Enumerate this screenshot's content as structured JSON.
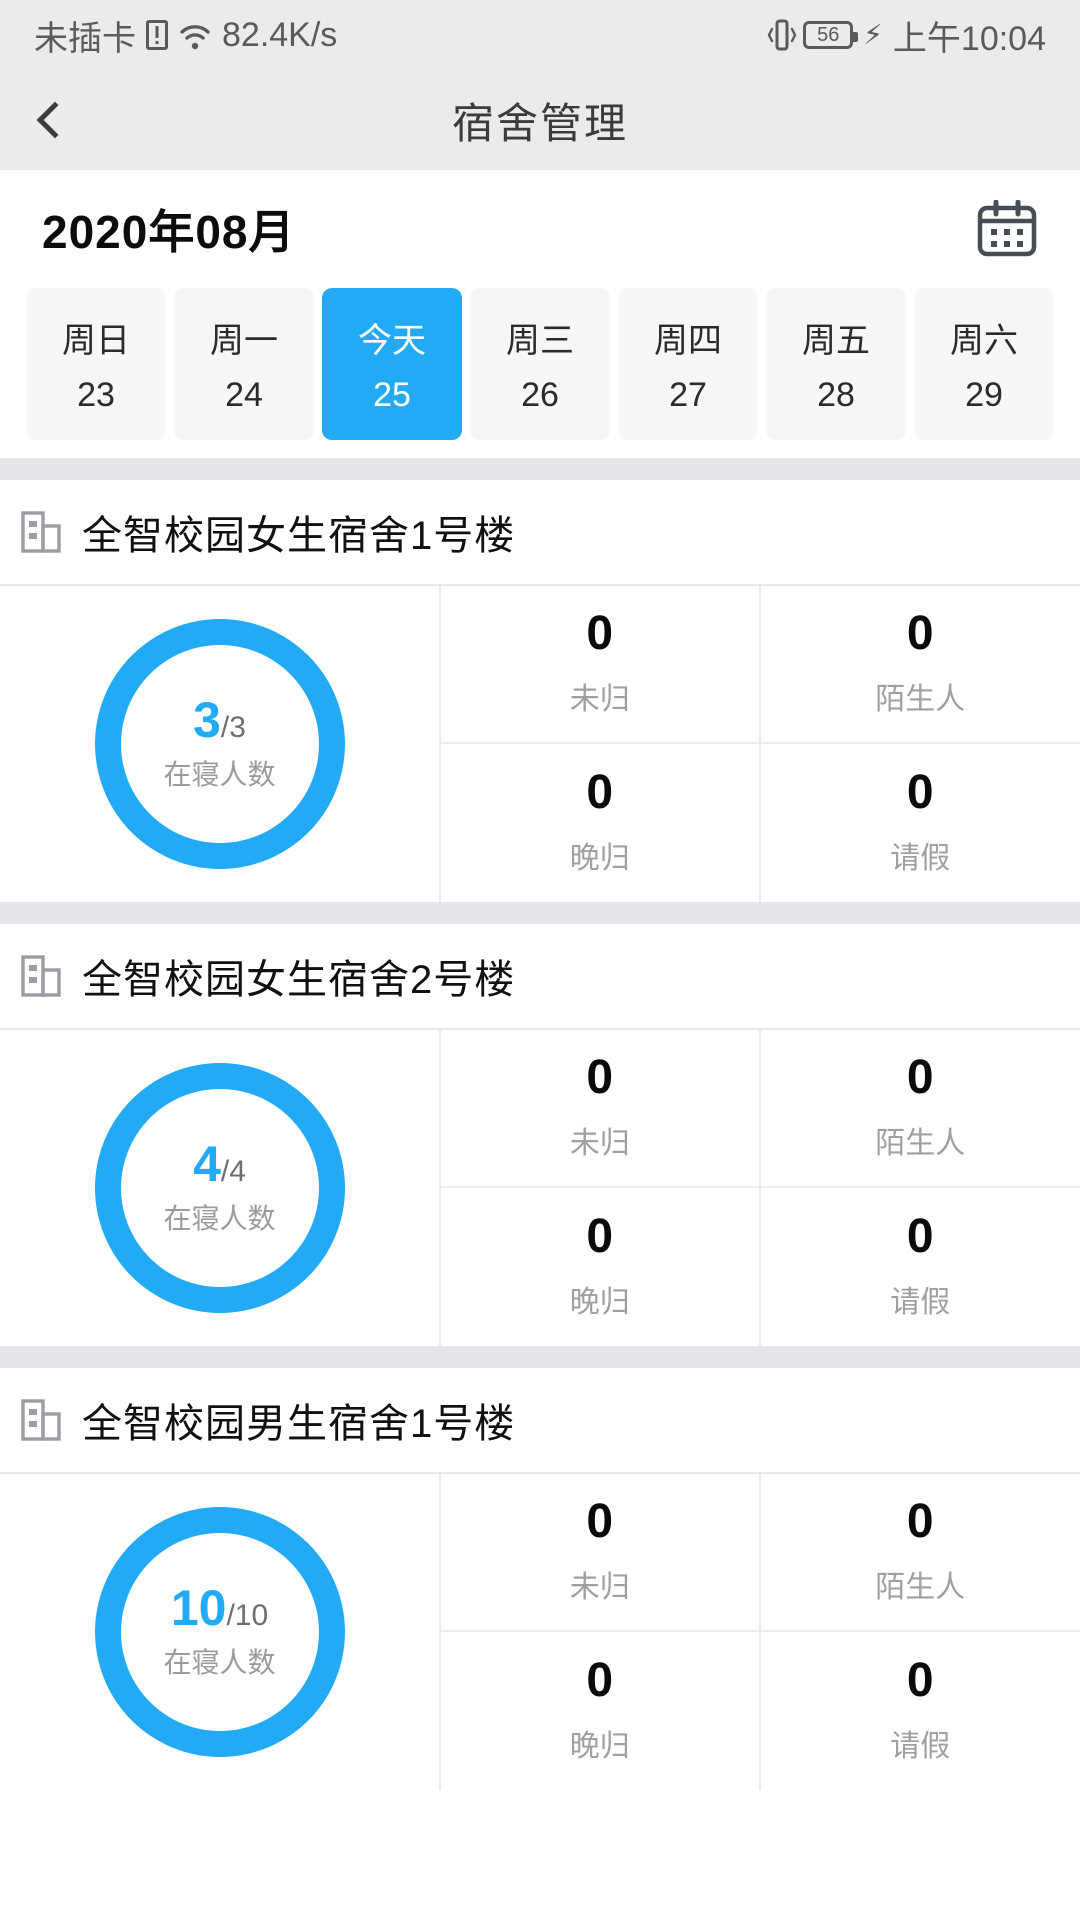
{
  "status_bar": {
    "carrier": "未插卡",
    "sim_icon": "sim-card-alert-icon",
    "wifi_icon": "wifi-icon",
    "network_speed": "82.4K/s",
    "vibrate_icon": "vibrate-icon",
    "battery_level": "56",
    "charging_icon": "charging-bolt-icon",
    "time": "上午10:04"
  },
  "header": {
    "back_icon": "back-chevron-icon",
    "title": "宿舍管理"
  },
  "calendar": {
    "month_label": "2020年08月",
    "calendar_icon": "calendar-icon",
    "days": [
      {
        "name": "周日",
        "date": "23",
        "selected": false
      },
      {
        "name": "周一",
        "date": "24",
        "selected": false
      },
      {
        "name": "今天",
        "date": "25",
        "selected": true
      },
      {
        "name": "周三",
        "date": "26",
        "selected": false
      },
      {
        "name": "周四",
        "date": "27",
        "selected": false
      },
      {
        "name": "周五",
        "date": "28",
        "selected": false
      },
      {
        "name": "周六",
        "date": "29",
        "selected": false
      }
    ]
  },
  "buildings": [
    {
      "icon": "building-icon",
      "name": "全智校园女生宿舍1号楼",
      "occupancy": {
        "current": "3",
        "total": "/3",
        "caption": "在寝人数"
      },
      "stats": [
        {
          "value": "0",
          "label": "未归"
        },
        {
          "value": "0",
          "label": "陌生人"
        },
        {
          "value": "0",
          "label": "晚归"
        },
        {
          "value": "0",
          "label": "请假"
        }
      ]
    },
    {
      "icon": "building-icon",
      "name": "全智校园女生宿舍2号楼",
      "occupancy": {
        "current": "4",
        "total": "/4",
        "caption": "在寝人数"
      },
      "stats": [
        {
          "value": "0",
          "label": "未归"
        },
        {
          "value": "0",
          "label": "陌生人"
        },
        {
          "value": "0",
          "label": "晚归"
        },
        {
          "value": "0",
          "label": "请假"
        }
      ]
    },
    {
      "icon": "building-icon",
      "name": "全智校园男生宿舍1号楼",
      "occupancy": {
        "current": "10",
        "total": "/10",
        "caption": "在寝人数"
      },
      "stats": [
        {
          "value": "0",
          "label": "未归"
        },
        {
          "value": "0",
          "label": "陌生人"
        },
        {
          "value": "0",
          "label": "晚归"
        },
        {
          "value": "0",
          "label": "请假"
        }
      ]
    }
  ],
  "colors": {
    "accent": "#22aaf5",
    "status_bar_bg": "#ebebeb",
    "band": "#e6e7ea",
    "muted_text": "#a0a0a0"
  }
}
